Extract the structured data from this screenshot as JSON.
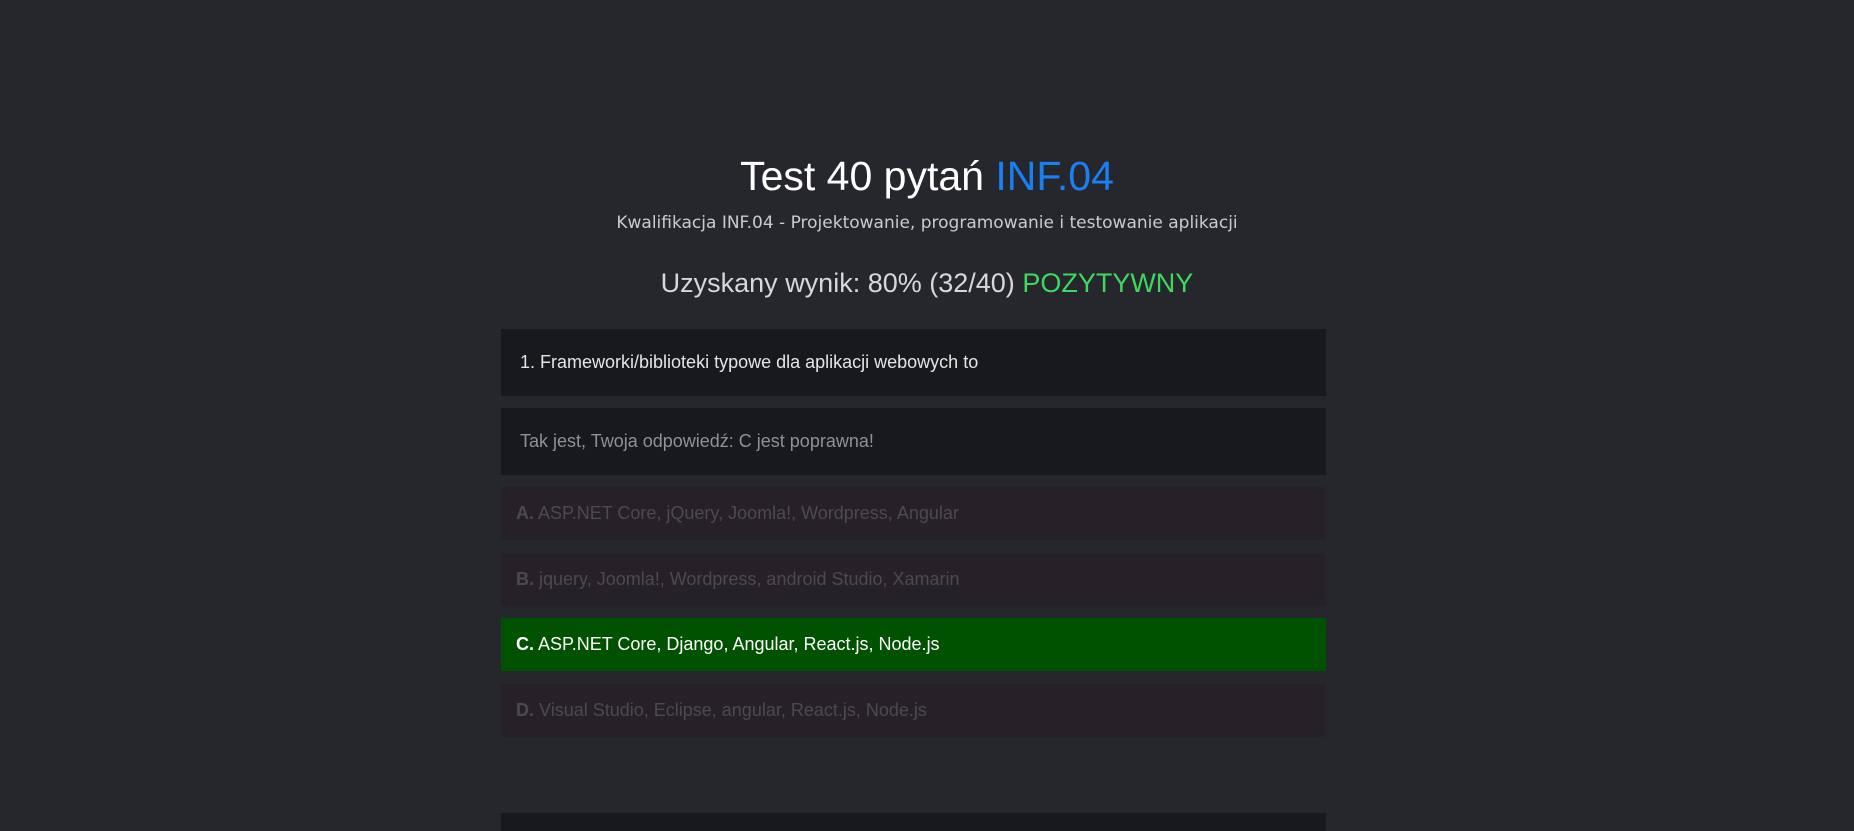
{
  "header": {
    "title_prefix": "Test 40 pytań",
    "title_accent": "INF.04",
    "subtitle": "Kwalifikacja INF.04 - Projektowanie, programowanie i testowanie aplikacji"
  },
  "result": {
    "label": "Uzyskany wynik: 80% (32/40)",
    "status": "POZYTYWNY"
  },
  "question": {
    "text": "1. Frameworki/biblioteki typowe dla aplikacji webowych to",
    "feedback": "Tak jest, Twoja odpowiedź: C jest poprawna!",
    "answers": [
      {
        "letter": "A.",
        "text": "ASP.NET Core, jQuery, Joomla!, Wordpress, Angular"
      },
      {
        "letter": "B.",
        "text": "jquery, Joomla!, Wordpress, android Studio, Xamarin"
      },
      {
        "letter": "C.",
        "text": "ASP.NET Core, Django, Angular, React.js, Node.js"
      },
      {
        "letter": "D.",
        "text": "Visual Studio, Eclipse, angular, React.js, Node.js"
      }
    ]
  },
  "colors": {
    "background": "#26272d",
    "accent": "#1a7ff2",
    "pass": "#3fd85e",
    "correct_answer": "#005100",
    "inactive_answer": "#262126"
  }
}
